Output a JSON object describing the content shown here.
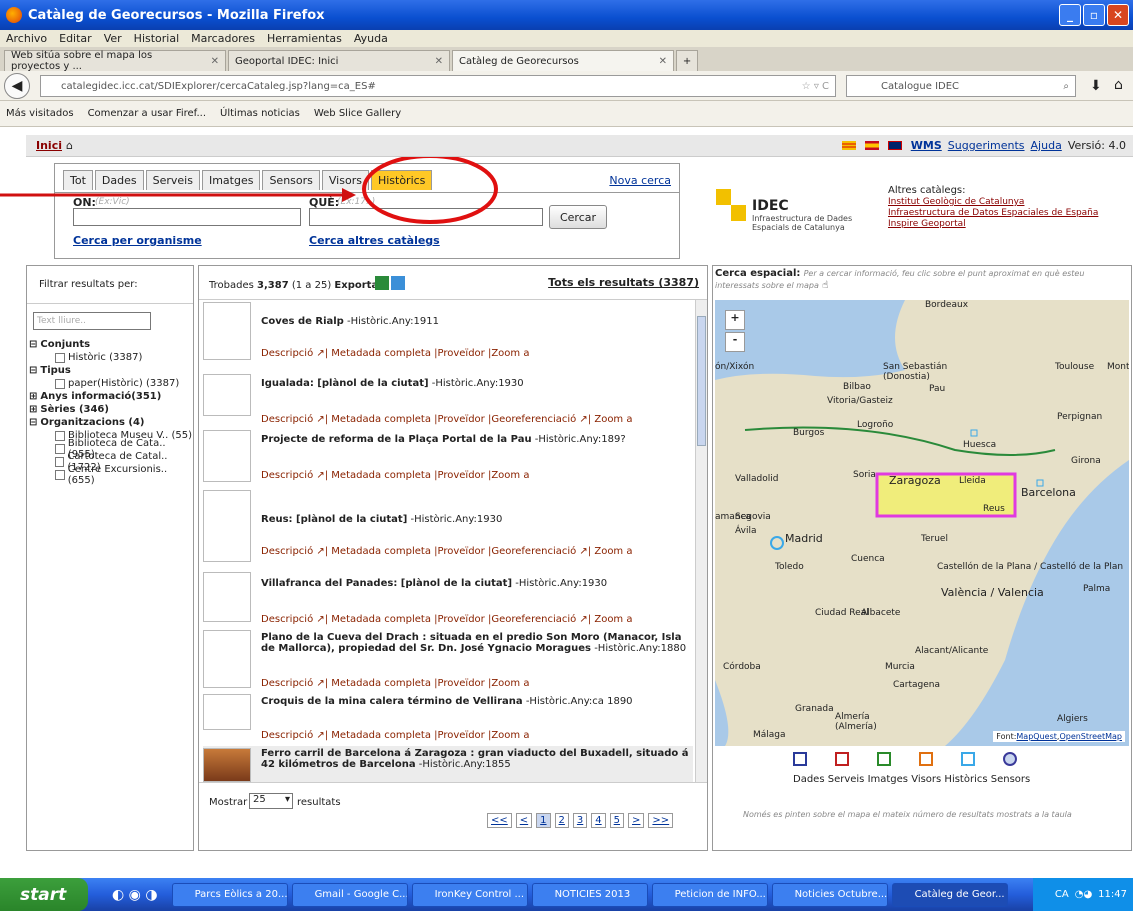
{
  "window": {
    "title": "Catàleg de Georecursos - Mozilla Firefox"
  },
  "menu": [
    "Archivo",
    "Editar",
    "Ver",
    "Historial",
    "Marcadores",
    "Herramientas",
    "Ayuda"
  ],
  "tabs": [
    {
      "label": "Web sitúa sobre el mapa los proyectos y ..."
    },
    {
      "label": "Geoportal IDEC: Inici"
    },
    {
      "label": "Catàleg de Georecursos"
    }
  ],
  "url": "catalegidec.icc.cat/SDIExplorer/cercaCataleg.jsp?lang=ca_ES#",
  "search_engine": "Catalogue IDEC",
  "bookmarks": [
    "Más visitados",
    "Comenzar a usar Firef...",
    "Últimas noticias",
    "Web Slice Gallery"
  ],
  "header": {
    "home": "Inici",
    "wms": "WMS",
    "suggest": "Suggeriments",
    "help": "Ajuda",
    "version": "Versió: 4.0"
  },
  "search": {
    "tabs": [
      "Tot",
      "Dades",
      "Serveis",
      "Imatges",
      "Sensors",
      "Visors",
      "Històrics"
    ],
    "new_search": "Nova cerca",
    "on_label": "ON:",
    "on_placeholder": "(Ex:Vic)",
    "que_label": "QUÈ:",
    "que_placeholder": "(Ex:17..)",
    "button": "Cercar",
    "by_org": "Cerca per organisme",
    "other_cats": "Cerca altres catàlegs"
  },
  "idec": {
    "name": "IDEC",
    "sub1": "Infraestructura de Dades",
    "sub2": "Espacials de Catalunya"
  },
  "other_catalogs": {
    "title": "Altres catàlegs:",
    "items": [
      "Institut Geològic de Catalunya",
      "Infraestructura de Datos Espaciales de España",
      "Inspire Geoportal"
    ]
  },
  "filters": {
    "title": "Filtrar resultats per:",
    "text_placeholder": "Text lliure..",
    "groups": [
      {
        "label": "Conjunts",
        "items": [
          "Històric (3387)"
        ]
      },
      {
        "label": "Tipus",
        "items": [
          "paper(Històric) (3387)"
        ]
      },
      {
        "label": "Anys informació(351)",
        "items": []
      },
      {
        "label": "Sèries (346)",
        "items": []
      },
      {
        "label": "Organitzacions (4)",
        "items": [
          "Biblioteca Museu V.. (55)",
          "Biblioteca de Cata.. (955)",
          "Cartoteca de Catal.. (1722)",
          "Centre Excursionis.. (655)"
        ]
      }
    ]
  },
  "results": {
    "found_prefix": "Trobades",
    "found_count": "3,387",
    "found_range": "(1 a 25)",
    "export": "Exportar",
    "all": "Tots els resultats (3387)",
    "items": [
      {
        "title": "Coves de Rialp",
        "meta": "-Històric.Any:1911",
        "links": "Descripció ↗| Metadada completa |Proveïdor |Zoom a"
      },
      {
        "title": "Igualada: [plànol de la ciutat]",
        "meta": "-Històric.Any:1930",
        "links": "Descripció ↗| Metadada completa |Proveïdor |Georeferenciació ↗| Zoom a"
      },
      {
        "title": "Projecte de reforma de la Plaça Portal de la Pau",
        "meta": "-Històric.Any:189?",
        "links": "Descripció ↗| Metadada completa |Proveïdor |Zoom a"
      },
      {
        "title": "Reus: [plànol de la ciutat]",
        "meta": "-Històric.Any:1930",
        "links": "Descripció ↗| Metadada completa |Proveïdor |Georeferenciació ↗| Zoom a"
      },
      {
        "title": "Villafranca del Panades: [plànol de la ciutat]",
        "meta": "-Històric.Any:1930",
        "links": "Descripció ↗| Metadada completa |Proveïdor |Georeferenciació ↗| Zoom a"
      },
      {
        "title": "Plano de la Cueva del Drach : situada en el predio Son Moro (Manacor, Isla de Mallorca), propiedad del Sr. Dn. José Ygnacio Moragues",
        "meta": "-Històric.Any:1880",
        "links": "Descripció ↗| Metadada completa |Proveïdor |Zoom a"
      },
      {
        "title": "Croquis de la mina calera término de Vellirana",
        "meta": "-Històric.Any:ca 1890",
        "links": "Descripció ↗| Metadada completa |Proveïdor |Zoom a"
      },
      {
        "title": "Ferro carril de Barcelona á Zaragoza : gran viaducto del Buxadell, situado á 42 kilómetros de Barcelona",
        "meta": "-Històric.Any:1855",
        "links": ""
      }
    ],
    "show_label": "Mostrar",
    "show_value": "25",
    "show_suffix": "resultats",
    "pages": [
      "<<",
      "<",
      "1",
      "2",
      "3",
      "4",
      "5",
      ">",
      ">>"
    ]
  },
  "map": {
    "title": "Cerca espacial:",
    "hint": "Per a cercar informació, feu clic sobre el punt aproximat en què esteu interessats sobre el mapa",
    "cities": [
      "Bordeaux",
      "Toulouse",
      "Montpe",
      "San Sebastián",
      "(Donostia)",
      "Bilbao",
      "Pau",
      "Vitoria/Gasteiz",
      "Perpignan",
      "Burgos",
      "Logroño",
      "Huesca",
      "Girona",
      "Valladolid",
      "Soria",
      "Zaragoza",
      "Lleida",
      "Barcelona",
      "Reus",
      "Segovia",
      "Ávila",
      "Madrid",
      "Teruel",
      "Toledo",
      "Cuenca",
      "Castellón de la Plana / Castelló de la Plan",
      "València / Valencia",
      "Palma",
      "Ciudad Real",
      "Albacete",
      "Alacant/Alicante",
      "Córdoba",
      "Murcia",
      "Cartagena",
      "Granada",
      "Almería",
      "(Almería)",
      "Málaga",
      "Algiers",
      "ón/Xixón",
      "amanca"
    ],
    "credit_prefix": "Font:",
    "credit1": "MapQuest",
    "credit2": "OpenStreetMap",
    "legend": "Dades Serveis Imatges Visors Històrics Sensors",
    "note": "Només es pinten sobre el mapa el mateix número de resultats mostrats a la taula"
  },
  "taskbar": {
    "start": "start",
    "tasks": [
      "Parcs Eòlics a 20...",
      "Gmail - Google C...",
      "IronKey Control ...",
      "NOTICIES 2013",
      "Peticion de INFO...",
      "Noticies Octubre...",
      "Catàleg de Geor..."
    ],
    "lang": "CA",
    "time": "11:47"
  }
}
